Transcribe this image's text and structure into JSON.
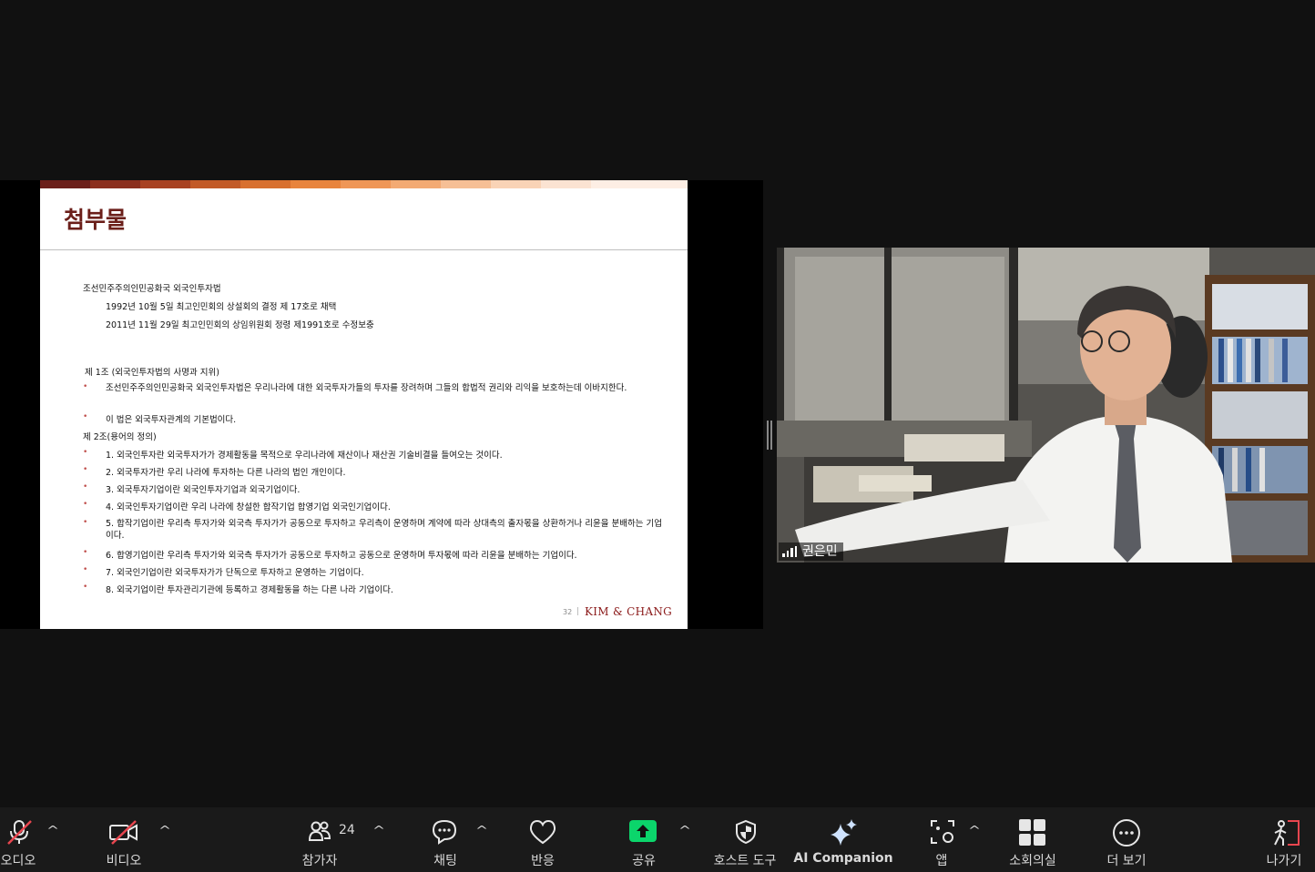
{
  "slide": {
    "title": "첨부물",
    "law_title": "조선민주주의인민공화국 외국인투자법",
    "adopted": "1992년 10월 5일 최고인민회의 상설회의 결정 제 17호로 채택",
    "amended": "2011년 11월 29일 최고인민회의 상임위원회 정령 제1991호로 수정보충",
    "article1_heading": "제 1조 (외국인투자법의 사명과 지위)",
    "article1_items": [
      "조선민주주의인민공화국 외국인투자법은 우리나라에 대한 외국투자가들의 투자를 장려하며 그들의 합법적 권리와 리익을 보호하는데 이바지한다.",
      "이 법은 외국투자관계의 기본법이다."
    ],
    "article2_heading": "제 2조(용어의 정의)",
    "article2_items": [
      "1. 외국인투자란 외국투자가가 경제활동을 목적으로 우리나라에 재산이나 재산권 기술비결을 들여오는 것이다.",
      "2. 외국투자가란 우리 나라에 투자하는 다른 나라의 법인 개인이다.",
      "3. 외국투자기업이란 외국인투자기업과 외국기업이다.",
      "4. 외국인투자기업이란 우리 나라에 창설한 합작기업 합영기업 외국인기업이다.",
      "5. 합작기업이란 우리측 투자가와 외국측 투자가가 공동으로 투자하고 우리측이 운영하며 계약에 따라 상대측의 출자몫을 상환하거나 리윤을 분배하는 기업이다.",
      "6. 합영기업이란 우리측 투자가와 외국측 투자가가 공동으로 투자하고 공동으로 운영하며 투자몫에 따라 리윤을 분배하는 기업이다.",
      "7. 외국인기업이란 외국투자가가 단독으로 투자하고 운영하는 기업이다.",
      "8. 외국기업이란 투자관리기관에 등록하고 경제활동을 하는 다른 나라 기업이다."
    ],
    "bullet_char": "•",
    "page_number": "32",
    "page_separator": "|",
    "brand": "KIM & CHANG",
    "stripe_colors": [
      "#6b1f1a",
      "#8b2f1e",
      "#a84222",
      "#c25a27",
      "#d8702f",
      "#e8843d",
      "#ef9656",
      "#f3aa73",
      "#f6bf95",
      "#f9d3b6",
      "#fbe3d2",
      "#fdeee4"
    ]
  },
  "participant": {
    "name": "권은민"
  },
  "toolbar": {
    "audio_label": "오디오",
    "video_label": "비디오",
    "participants_label": "참가자",
    "participants_count": "24",
    "chat_label": "채팅",
    "reactions_label": "반응",
    "share_label": "공유",
    "host_tools_label": "호스트 도구",
    "ai_label": "AI Companion",
    "apps_label": "앱",
    "breakout_label": "소회의실",
    "more_label": "더 보기",
    "leave_label": "나가기",
    "caret": "^",
    "share_accent": "#0bd56b",
    "mute_color": "#e8464f"
  }
}
